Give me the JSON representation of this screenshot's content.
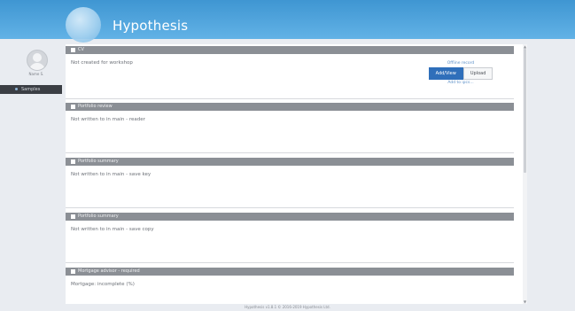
{
  "header": {
    "app_title": "Hypothesis"
  },
  "sidebar": {
    "user_name": "Name S.",
    "items": [
      {
        "label": "Samples"
      }
    ]
  },
  "panels": [
    {
      "title": "CV",
      "text": "Not created for workshop",
      "side": {
        "top_link": "Offline record",
        "primary_button": "Add/View",
        "secondary_button": "Upload",
        "bottom_link": "Add to ipcs..."
      }
    },
    {
      "title": "Portfolio review",
      "text": "Not written to in main - reader"
    },
    {
      "title": "Portfolio summary",
      "text": "Not written to in main - save key"
    },
    {
      "title": "Portfolio summary",
      "text": "Not written to in main - save copy"
    },
    {
      "title": "Mortgage advisor - required",
      "text": "Mortgage: incomplete (%)"
    }
  ],
  "footer": {
    "text": "Hypothesis   v1.8.1   © 2016-2019 Hypothesis Ltd."
  }
}
